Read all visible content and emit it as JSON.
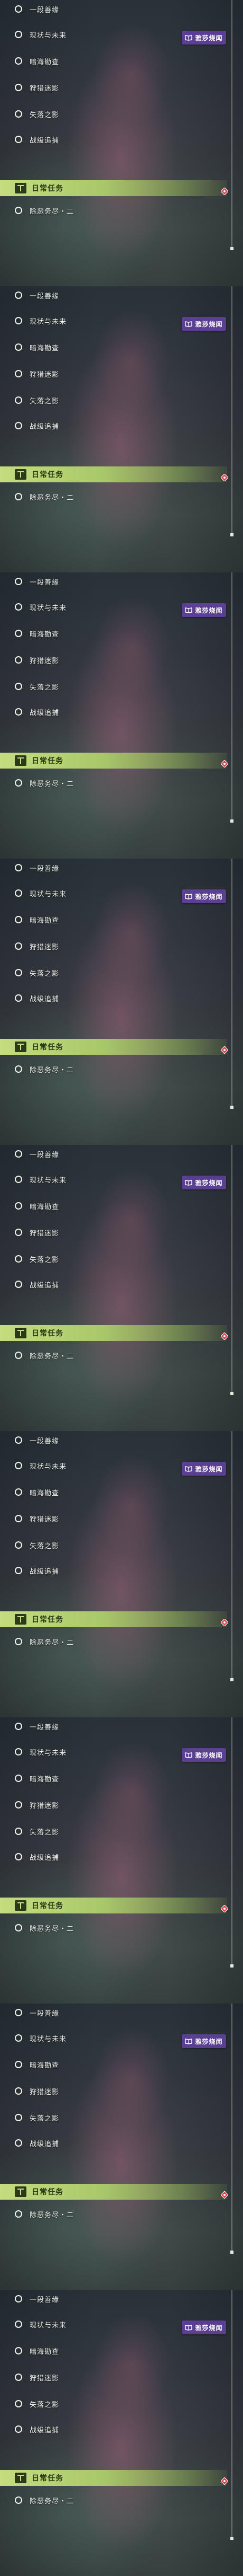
{
  "items": [
    "一段善缘",
    "现状与未来",
    "暗海勘查",
    "狩猎迷影",
    "失落之影",
    "战级追捕"
  ],
  "tag": {
    "label": "雅莎烧闻",
    "color": "#5b3f93"
  },
  "section": {
    "title": "日常任务",
    "icon": "daily-quest-icon",
    "color": "#b8d27a"
  },
  "daily_item": "除恶务尽・二",
  "repeat_count": 9
}
